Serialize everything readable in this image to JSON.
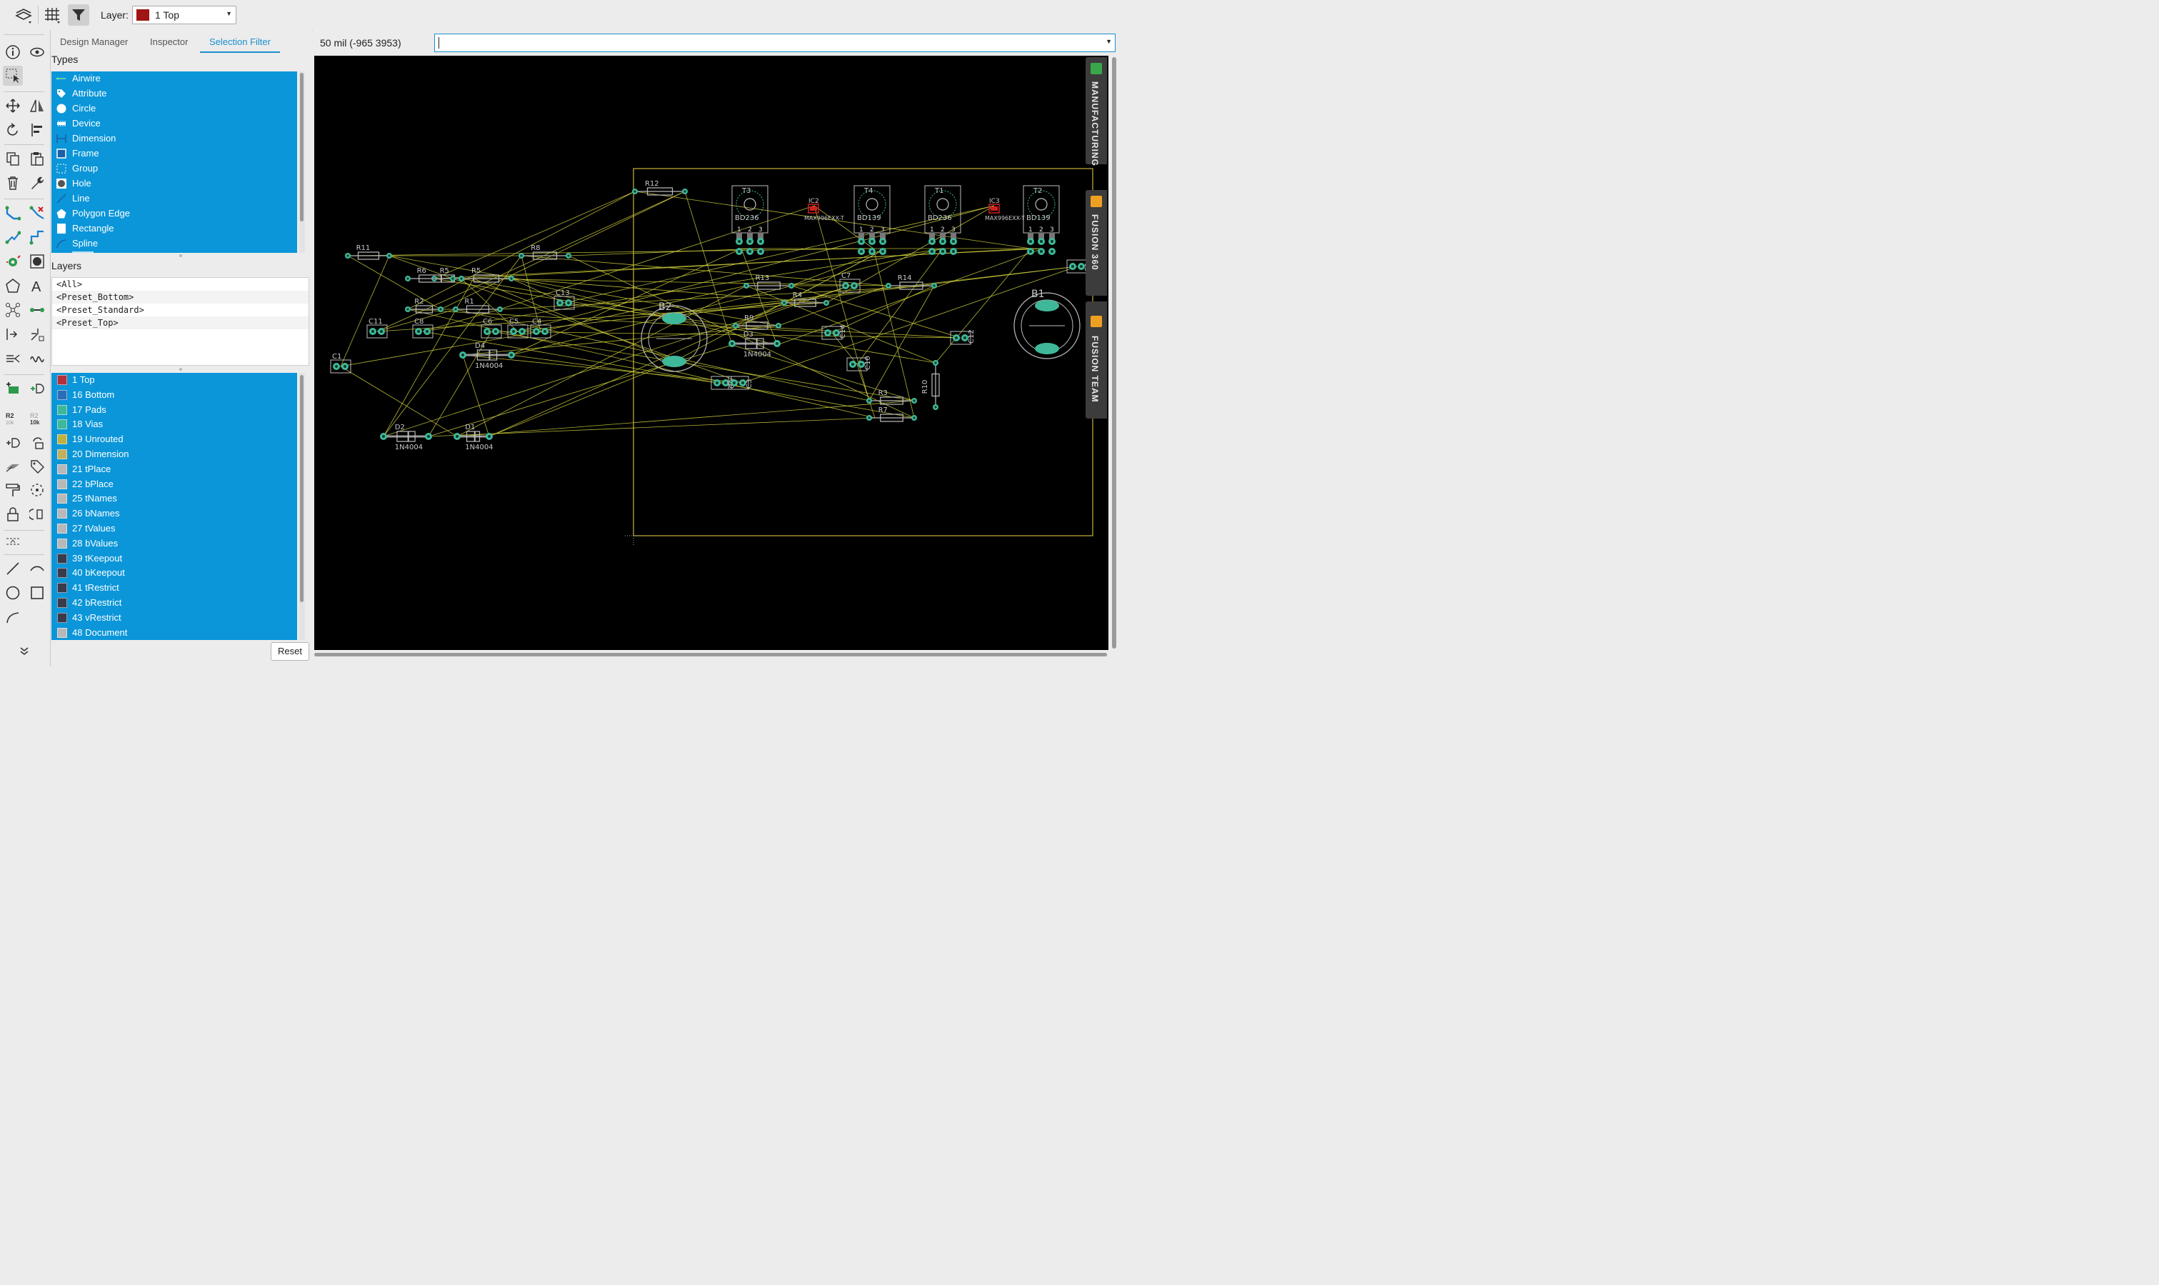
{
  "toolbar": {
    "icons": [
      "layers-icon",
      "grid-icon",
      "filter-icon"
    ],
    "layer_label": "Layer:",
    "layer_value": "1 Top",
    "layer_color": "#a11515"
  },
  "panel": {
    "tabs": [
      {
        "label": "Design Manager",
        "selected": false
      },
      {
        "label": "Inspector",
        "selected": false
      },
      {
        "label": "Selection Filter",
        "selected": true
      }
    ],
    "types_title": "Types",
    "types": [
      {
        "label": "Airwire",
        "icon": "airwire-icon"
      },
      {
        "label": "Attribute",
        "icon": "tag-icon"
      },
      {
        "label": "Circle",
        "icon": "circle-icon"
      },
      {
        "label": "Device",
        "icon": "device-icon"
      },
      {
        "label": "Dimension",
        "icon": "dimension-icon"
      },
      {
        "label": "Frame",
        "icon": "frame-icon"
      },
      {
        "label": "Group",
        "icon": "group-icon"
      },
      {
        "label": "Hole",
        "icon": "hole-icon"
      },
      {
        "label": "Line",
        "icon": "line-icon"
      },
      {
        "label": "Polygon Edge",
        "icon": "polygon-icon"
      },
      {
        "label": "Rectangle",
        "icon": "rectangle-icon"
      },
      {
        "label": "Spline",
        "icon": "spline-icon"
      }
    ],
    "layers_title": "Layers",
    "presets": [
      "<All>",
      "<Preset_Bottom>",
      "<Preset_Standard>",
      "<Preset_Top>"
    ],
    "layers": [
      {
        "label": "1 Top",
        "color": "#b4303a"
      },
      {
        "label": "16 Bottom",
        "color": "#2c6cb8"
      },
      {
        "label": "17 Pads",
        "color": "#3fb89a"
      },
      {
        "label": "18 Vias",
        "color": "#3fb89a"
      },
      {
        "label": "19 Unrouted",
        "color": "#c0b040"
      },
      {
        "label": "20 Dimension",
        "color": "#c0b060"
      },
      {
        "label": "21 tPlace",
        "color": "#b8b8b8"
      },
      {
        "label": "22 bPlace",
        "color": "#b8b8b8"
      },
      {
        "label": "25 tNames",
        "color": "#b8b8b8"
      },
      {
        "label": "26 bNames",
        "color": "#b8b8b8"
      },
      {
        "label": "27 tValues",
        "color": "#b8b8b8"
      },
      {
        "label": "28 bValues",
        "color": "#b8b8b8"
      },
      {
        "label": "39 tKeepout",
        "color": "#3a3a4a"
      },
      {
        "label": "40 bKeepout",
        "color": "#3a3a4a"
      },
      {
        "label": "41 tRestrict",
        "color": "#3a3a4a"
      },
      {
        "label": "42 bRestrict",
        "color": "#3a3a4a"
      },
      {
        "label": "43 vRestrict",
        "color": "#3a3a4a"
      },
      {
        "label": "48 Document",
        "color": "#b8b8b8"
      }
    ],
    "reset_label": "Reset"
  },
  "command": {
    "coordinates": "50 mil (-965 3953)",
    "value": ""
  },
  "side_tabs": [
    {
      "label": "MANUFACTURING",
      "badge_color": "#3aa64a"
    },
    {
      "label": "FUSION 360",
      "badge_color": "#f0a020"
    },
    {
      "label": "FUSION TEAM",
      "badge_color": "#f0a020"
    }
  ],
  "board": {
    "outline_color": "#c9b33a",
    "airwire_color": "#c9c93a",
    "pad_color": "#3fb89a",
    "components": [
      {
        "name": "R12"
      },
      {
        "name": "R11"
      },
      {
        "name": "R8"
      },
      {
        "name": "R6"
      },
      {
        "name": "R5"
      },
      {
        "name": "R2"
      },
      {
        "name": "R1"
      },
      {
        "name": "C13"
      },
      {
        "name": "C11"
      },
      {
        "name": "C8"
      },
      {
        "name": "C6"
      },
      {
        "name": "C5"
      },
      {
        "name": "C4"
      },
      {
        "name": "D4"
      },
      {
        "name": "1N4004"
      },
      {
        "name": "C1"
      },
      {
        "name": "D2"
      },
      {
        "name": "1N4004"
      },
      {
        "name": "D1"
      },
      {
        "name": "1N4004"
      },
      {
        "name": "T3"
      },
      {
        "name": "BD236"
      },
      {
        "name": "IC2"
      },
      {
        "name": "MAX996EXX-T"
      },
      {
        "name": "T4"
      },
      {
        "name": "BD139"
      },
      {
        "name": "T1"
      },
      {
        "name": "BD236"
      },
      {
        "name": "IC3"
      },
      {
        "name": "MAX996EXX-T"
      },
      {
        "name": "T2"
      },
      {
        "name": "BD139"
      },
      {
        "name": "R13"
      },
      {
        "name": "C7"
      },
      {
        "name": "R14"
      },
      {
        "name": "C2"
      },
      {
        "name": "R4"
      },
      {
        "name": "B2"
      },
      {
        "name": "B1"
      },
      {
        "name": "R9"
      },
      {
        "name": "D3"
      },
      {
        "name": "1N4004"
      },
      {
        "name": "C14"
      },
      {
        "name": "C12"
      },
      {
        "name": "C10"
      },
      {
        "name": "C9"
      },
      {
        "name": "C3"
      },
      {
        "name": "R10"
      },
      {
        "name": "R3"
      },
      {
        "name": "R7"
      }
    ],
    "pin_numbers": [
      "1",
      "2",
      "3"
    ]
  }
}
